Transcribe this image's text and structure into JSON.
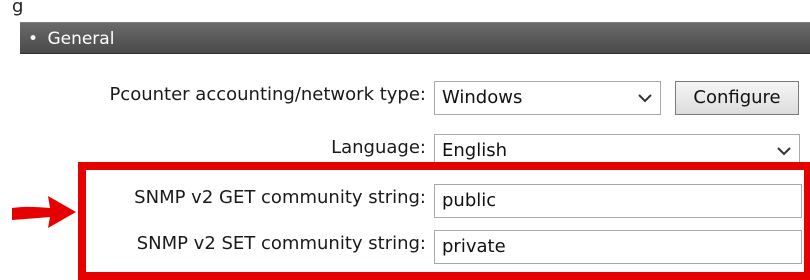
{
  "top_fragment": "g",
  "section": {
    "bullet": "•",
    "title": "General"
  },
  "rows": {
    "accounting": {
      "label": "Pcounter accounting/network type:",
      "value": "Windows",
      "button": "Configure"
    },
    "language": {
      "label": "Language:",
      "value": "English"
    },
    "snmp_get": {
      "label": "SNMP v2 GET community string:",
      "value": "public"
    },
    "snmp_set": {
      "label": "SNMP v2 SET community string:",
      "value": "private"
    }
  },
  "colors": {
    "highlight": "#e60000",
    "header_bg": "#555555"
  },
  "icons": {
    "dropdown": "chevron-down-icon",
    "pointer": "arrow-right-icon"
  }
}
